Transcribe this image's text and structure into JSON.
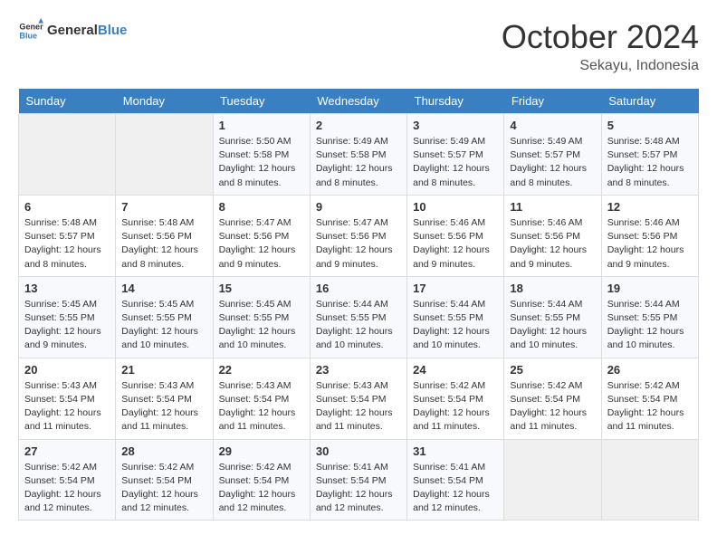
{
  "logo": {
    "text_general": "General",
    "text_blue": "Blue"
  },
  "title": "October 2024",
  "location": "Sekayu, Indonesia",
  "days_of_week": [
    "Sunday",
    "Monday",
    "Tuesday",
    "Wednesday",
    "Thursday",
    "Friday",
    "Saturday"
  ],
  "weeks": [
    [
      {
        "day": "",
        "sunrise": "",
        "sunset": "",
        "daylight": ""
      },
      {
        "day": "",
        "sunrise": "",
        "sunset": "",
        "daylight": ""
      },
      {
        "day": "1",
        "sunrise": "Sunrise: 5:50 AM",
        "sunset": "Sunset: 5:58 PM",
        "daylight": "Daylight: 12 hours and 8 minutes."
      },
      {
        "day": "2",
        "sunrise": "Sunrise: 5:49 AM",
        "sunset": "Sunset: 5:58 PM",
        "daylight": "Daylight: 12 hours and 8 minutes."
      },
      {
        "day": "3",
        "sunrise": "Sunrise: 5:49 AM",
        "sunset": "Sunset: 5:57 PM",
        "daylight": "Daylight: 12 hours and 8 minutes."
      },
      {
        "day": "4",
        "sunrise": "Sunrise: 5:49 AM",
        "sunset": "Sunset: 5:57 PM",
        "daylight": "Daylight: 12 hours and 8 minutes."
      },
      {
        "day": "5",
        "sunrise": "Sunrise: 5:48 AM",
        "sunset": "Sunset: 5:57 PM",
        "daylight": "Daylight: 12 hours and 8 minutes."
      }
    ],
    [
      {
        "day": "6",
        "sunrise": "Sunrise: 5:48 AM",
        "sunset": "Sunset: 5:57 PM",
        "daylight": "Daylight: 12 hours and 8 minutes."
      },
      {
        "day": "7",
        "sunrise": "Sunrise: 5:48 AM",
        "sunset": "Sunset: 5:56 PM",
        "daylight": "Daylight: 12 hours and 8 minutes."
      },
      {
        "day": "8",
        "sunrise": "Sunrise: 5:47 AM",
        "sunset": "Sunset: 5:56 PM",
        "daylight": "Daylight: 12 hours and 9 minutes."
      },
      {
        "day": "9",
        "sunrise": "Sunrise: 5:47 AM",
        "sunset": "Sunset: 5:56 PM",
        "daylight": "Daylight: 12 hours and 9 minutes."
      },
      {
        "day": "10",
        "sunrise": "Sunrise: 5:46 AM",
        "sunset": "Sunset: 5:56 PM",
        "daylight": "Daylight: 12 hours and 9 minutes."
      },
      {
        "day": "11",
        "sunrise": "Sunrise: 5:46 AM",
        "sunset": "Sunset: 5:56 PM",
        "daylight": "Daylight: 12 hours and 9 minutes."
      },
      {
        "day": "12",
        "sunrise": "Sunrise: 5:46 AM",
        "sunset": "Sunset: 5:56 PM",
        "daylight": "Daylight: 12 hours and 9 minutes."
      }
    ],
    [
      {
        "day": "13",
        "sunrise": "Sunrise: 5:45 AM",
        "sunset": "Sunset: 5:55 PM",
        "daylight": "Daylight: 12 hours and 9 minutes."
      },
      {
        "day": "14",
        "sunrise": "Sunrise: 5:45 AM",
        "sunset": "Sunset: 5:55 PM",
        "daylight": "Daylight: 12 hours and 10 minutes."
      },
      {
        "day": "15",
        "sunrise": "Sunrise: 5:45 AM",
        "sunset": "Sunset: 5:55 PM",
        "daylight": "Daylight: 12 hours and 10 minutes."
      },
      {
        "day": "16",
        "sunrise": "Sunrise: 5:44 AM",
        "sunset": "Sunset: 5:55 PM",
        "daylight": "Daylight: 12 hours and 10 minutes."
      },
      {
        "day": "17",
        "sunrise": "Sunrise: 5:44 AM",
        "sunset": "Sunset: 5:55 PM",
        "daylight": "Daylight: 12 hours and 10 minutes."
      },
      {
        "day": "18",
        "sunrise": "Sunrise: 5:44 AM",
        "sunset": "Sunset: 5:55 PM",
        "daylight": "Daylight: 12 hours and 10 minutes."
      },
      {
        "day": "19",
        "sunrise": "Sunrise: 5:44 AM",
        "sunset": "Sunset: 5:55 PM",
        "daylight": "Daylight: 12 hours and 10 minutes."
      }
    ],
    [
      {
        "day": "20",
        "sunrise": "Sunrise: 5:43 AM",
        "sunset": "Sunset: 5:54 PM",
        "daylight": "Daylight: 12 hours and 11 minutes."
      },
      {
        "day": "21",
        "sunrise": "Sunrise: 5:43 AM",
        "sunset": "Sunset: 5:54 PM",
        "daylight": "Daylight: 12 hours and 11 minutes."
      },
      {
        "day": "22",
        "sunrise": "Sunrise: 5:43 AM",
        "sunset": "Sunset: 5:54 PM",
        "daylight": "Daylight: 12 hours and 11 minutes."
      },
      {
        "day": "23",
        "sunrise": "Sunrise: 5:43 AM",
        "sunset": "Sunset: 5:54 PM",
        "daylight": "Daylight: 12 hours and 11 minutes."
      },
      {
        "day": "24",
        "sunrise": "Sunrise: 5:42 AM",
        "sunset": "Sunset: 5:54 PM",
        "daylight": "Daylight: 12 hours and 11 minutes."
      },
      {
        "day": "25",
        "sunrise": "Sunrise: 5:42 AM",
        "sunset": "Sunset: 5:54 PM",
        "daylight": "Daylight: 12 hours and 11 minutes."
      },
      {
        "day": "26",
        "sunrise": "Sunrise: 5:42 AM",
        "sunset": "Sunset: 5:54 PM",
        "daylight": "Daylight: 12 hours and 11 minutes."
      }
    ],
    [
      {
        "day": "27",
        "sunrise": "Sunrise: 5:42 AM",
        "sunset": "Sunset: 5:54 PM",
        "daylight": "Daylight: 12 hours and 12 minutes."
      },
      {
        "day": "28",
        "sunrise": "Sunrise: 5:42 AM",
        "sunset": "Sunset: 5:54 PM",
        "daylight": "Daylight: 12 hours and 12 minutes."
      },
      {
        "day": "29",
        "sunrise": "Sunrise: 5:42 AM",
        "sunset": "Sunset: 5:54 PM",
        "daylight": "Daylight: 12 hours and 12 minutes."
      },
      {
        "day": "30",
        "sunrise": "Sunrise: 5:41 AM",
        "sunset": "Sunset: 5:54 PM",
        "daylight": "Daylight: 12 hours and 12 minutes."
      },
      {
        "day": "31",
        "sunrise": "Sunrise: 5:41 AM",
        "sunset": "Sunset: 5:54 PM",
        "daylight": "Daylight: 12 hours and 12 minutes."
      },
      {
        "day": "",
        "sunrise": "",
        "sunset": "",
        "daylight": ""
      },
      {
        "day": "",
        "sunrise": "",
        "sunset": "",
        "daylight": ""
      }
    ]
  ]
}
